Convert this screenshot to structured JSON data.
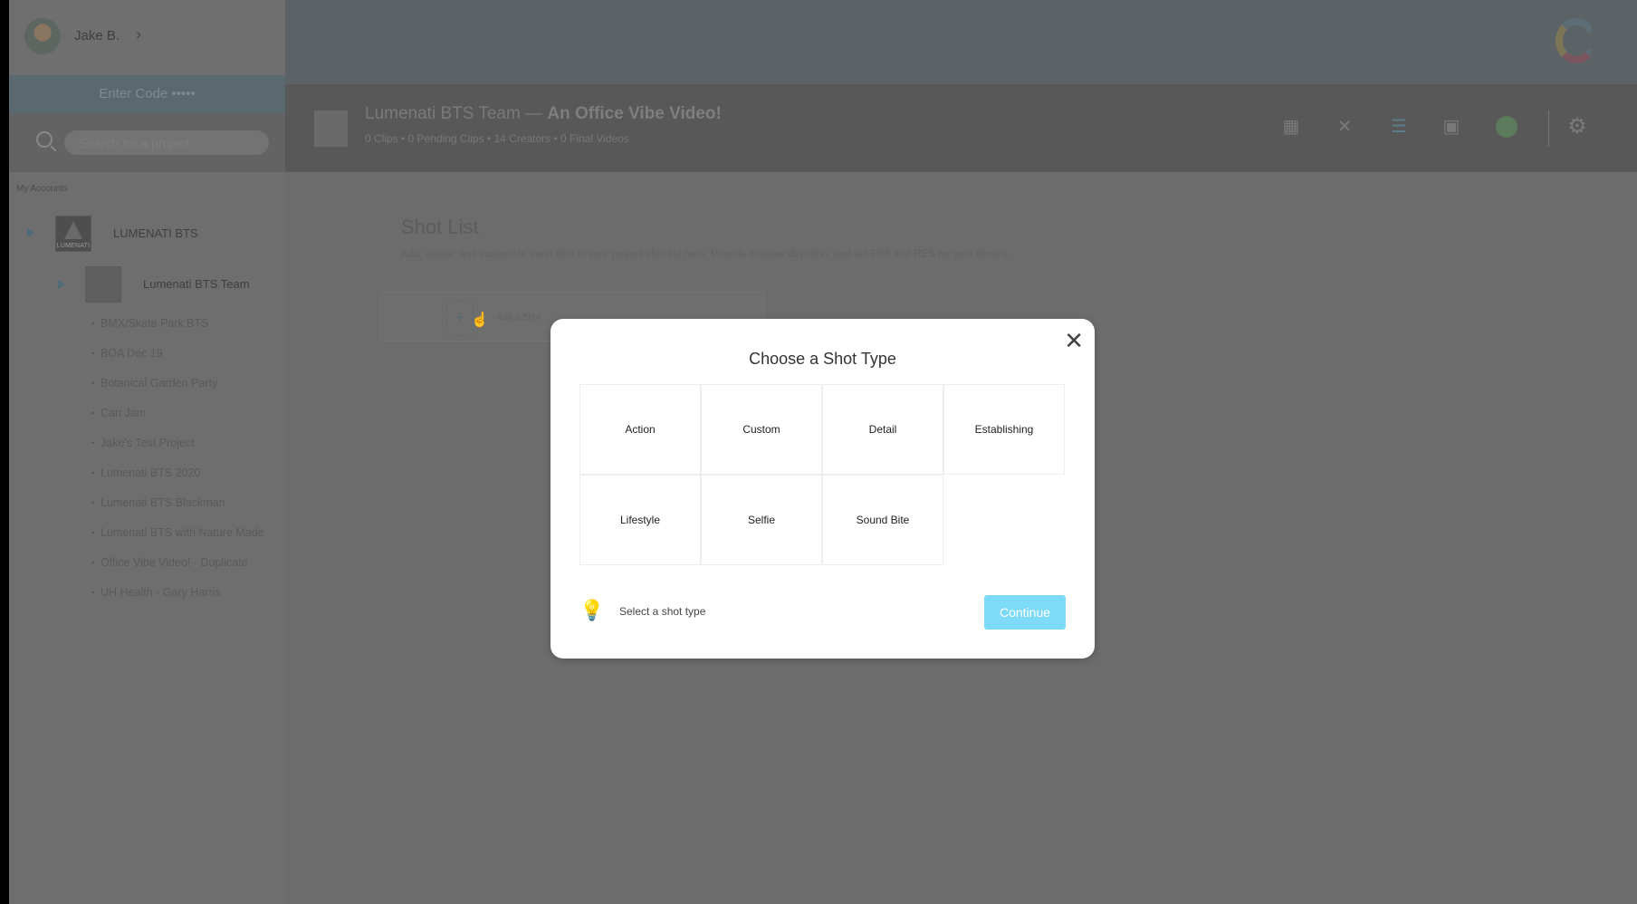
{
  "sidebar": {
    "user_name": "Jake B.",
    "enter_code": "Enter Code •••••",
    "search_placeholder": "Search for a project...",
    "section_label": "My Accounts",
    "account": "LUMENATI BTS",
    "account_logo_text": "LUMENATI",
    "team": "Lumenati BTS Team",
    "projects": [
      "BMX/Skate Park BTS",
      "BOA Dec 19",
      "Botanical Garden Party",
      "Can Jam",
      "Jake's Test Project",
      "Lumenati BTS 2020",
      "Lumenati BTS Blackman",
      "Lumenati BTS with Nature Made",
      "Office Vibe Video! - Duplicate",
      "UH Health - Gary Harris"
    ]
  },
  "project": {
    "team": "Lumenati BTS Team",
    "separator": "—",
    "name": "An Office Vibe Video!",
    "stats": "0 Clips • 0 Pending Clips • 14 Creators • 0 Final Videos",
    "toolbar_icons": [
      "grid-icon",
      "director-chair-icon",
      "list-icon",
      "video-stack-icon",
      "broadcast-icon",
      "gear-icon"
    ]
  },
  "shot_list": {
    "title": "Shot List",
    "description": "Add, delete, and customize each shot in your project shot list here. Provide creative direction, and set FPS and RES for your filmers.",
    "add_label": "Add a Shot"
  },
  "modal": {
    "title": "Choose a Shot Type",
    "types": [
      "Action",
      "Custom",
      "Detail",
      "Establishing",
      "Lifestyle",
      "Selfie",
      "Sound Bite"
    ],
    "hint": "Select a shot type",
    "continue": "Continue",
    "accent": "#7ddbf7"
  }
}
